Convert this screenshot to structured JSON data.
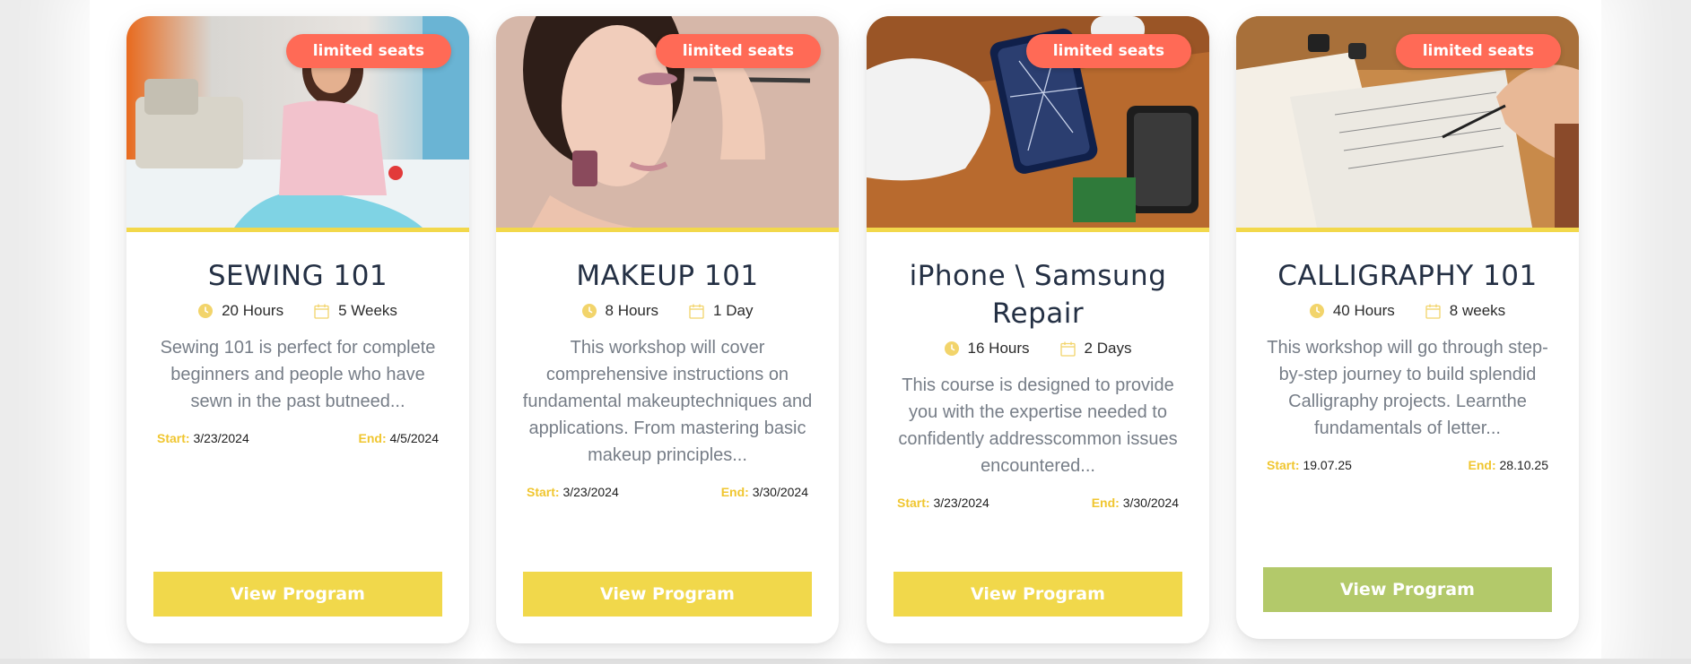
{
  "colors": {
    "badge": "#ff6a56",
    "accent_yellow": "#f1d84b",
    "accent_green": "#b3c96a",
    "title": "#243044",
    "text_muted": "#767d87"
  },
  "cards": [
    {
      "badge": "limited seats",
      "title": "SEWING 101",
      "hours": "20 Hours",
      "duration": "5 Weeks",
      "description": "Sewing 101 is perfect for complete beginners and people who have sewn in the past butneed...",
      "start_label": "Start:",
      "start": "3/23/2024",
      "end_label": "End:",
      "end": "4/5/2024",
      "button": "View Program",
      "image_icon": "sewing-photo"
    },
    {
      "badge": "limited seats",
      "title": "MAKEUP 101",
      "hours": "8 Hours",
      "duration": "1 Day",
      "description": "This workshop will cover comprehensive instructions on fundamental makeuptechniques and applications. From mastering basic makeup principles...",
      "start_label": "Start:",
      "start": "3/23/2024",
      "end_label": "End:",
      "end": "3/30/2024",
      "button": "View Program",
      "image_icon": "makeup-photo"
    },
    {
      "badge": "limited seats",
      "title": "iPhone \\ Samsung Repair",
      "hours": "16 Hours",
      "duration": "2 Days",
      "description": "This course is designed to provide you with the expertise needed to confidently addresscommon issues encountered...",
      "start_label": "Start:",
      "start": "3/23/2024",
      "end_label": "End:",
      "end": "3/30/2024",
      "button": "View Program",
      "image_icon": "phone-repair-photo"
    },
    {
      "badge": "limited seats",
      "title": "CALLIGRAPHY 101",
      "hours": "40 Hours",
      "duration": "8 weeks",
      "description": "This workshop will go through step-by-step journey to build splendid Calligraphy projects. Learnthe fundamentals of letter...",
      "start_label": "Start:",
      "start": "19.07.25",
      "end_label": "End:",
      "end": "28.10.25",
      "button": "View Program",
      "image_icon": "calligraphy-photo"
    }
  ]
}
